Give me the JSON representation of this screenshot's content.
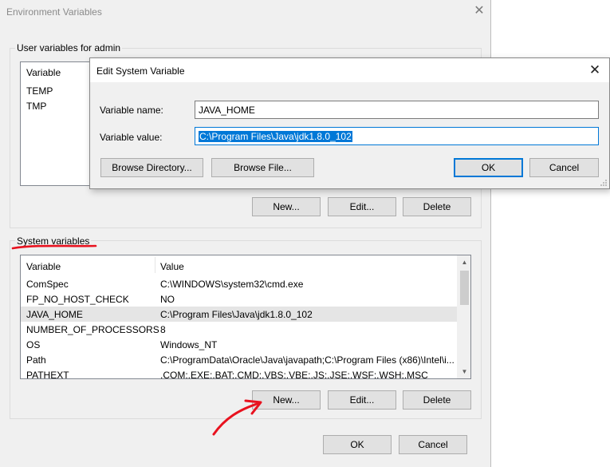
{
  "outer_window": {
    "title": "Environment Variables",
    "user_group_label": "User variables for admin",
    "user_list": {
      "header_variable": "Variable",
      "rows": [
        {
          "variable": "TEMP"
        },
        {
          "variable": "TMP"
        }
      ]
    },
    "user_buttons": {
      "new": "New...",
      "edit": "Edit...",
      "delete": "Delete"
    },
    "system_group_label": "System variables",
    "system_list": {
      "header_variable": "Variable",
      "header_value": "Value",
      "rows": [
        {
          "variable": "ComSpec",
          "value": "C:\\WINDOWS\\system32\\cmd.exe"
        },
        {
          "variable": "FP_NO_HOST_CHECK",
          "value": "NO"
        },
        {
          "variable": "JAVA_HOME",
          "value": "C:\\Program Files\\Java\\jdk1.8.0_102"
        },
        {
          "variable": "NUMBER_OF_PROCESSORS",
          "value": "8"
        },
        {
          "variable": "OS",
          "value": "Windows_NT"
        },
        {
          "variable": "Path",
          "value": "C:\\ProgramData\\Oracle\\Java\\javapath;C:\\Program Files (x86)\\Intel\\i..."
        },
        {
          "variable": "PATHEXT",
          "value": ".COM;.EXE;.BAT;.CMD;.VBS;.VBE;.JS;.JSE;.WSF;.WSH;.MSC"
        }
      ]
    },
    "system_buttons": {
      "new": "New...",
      "edit": "Edit...",
      "delete": "Delete"
    },
    "footer_buttons": {
      "ok": "OK",
      "cancel": "Cancel"
    }
  },
  "edit_dialog": {
    "title": "Edit System Variable",
    "name_label": "Variable name:",
    "name_value": "JAVA_HOME",
    "value_label": "Variable value:",
    "value_value": "C:\\Program Files\\Java\\jdk1.8.0_102",
    "buttons": {
      "browse_directory": "Browse Directory...",
      "browse_file": "Browse File...",
      "ok": "OK",
      "cancel": "Cancel"
    }
  },
  "icons": {
    "outer_close": "close-icon",
    "dialog_close": "close-icon",
    "scroll_up": "chevron-up-icon",
    "scroll_down": "chevron-down-icon"
  },
  "colors": {
    "annotation": "#e8121f",
    "selection": "#0078d7",
    "window_bg": "#f0f0f0"
  }
}
